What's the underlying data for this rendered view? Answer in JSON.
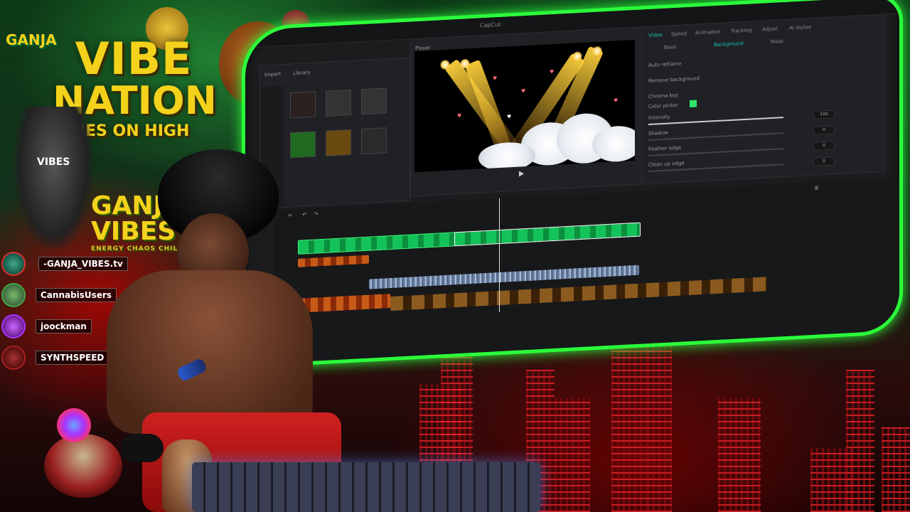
{
  "overlay": {
    "ganja_small": "GANJA",
    "title_line1": "VIBE",
    "title_line2": "NATION",
    "title_line3": "VIBES ON HIGH",
    "shirt_text": "VIBES",
    "logo_line1": "GANJ",
    "logo_line2": "VIBES",
    "logo_sub": "ENERGY CHAOS CHILL"
  },
  "chat_users": [
    {
      "name": "-GANJA_VIBES.tv",
      "icon": "avatar-icon"
    },
    {
      "name": "CannabisUsers",
      "icon": "avatar-icon"
    },
    {
      "name": "joockman",
      "icon": "avatar-icon"
    },
    {
      "name": "SYNTHSPEED",
      "icon": "avatar-icon"
    }
  ],
  "editor": {
    "window_title": "CapCut",
    "media_tabs": [
      "Import",
      "Library"
    ],
    "media_items": [
      {
        "label": ""
      },
      {
        "label": ""
      },
      {
        "label": ""
      },
      {
        "label": ""
      },
      {
        "label": ""
      },
      {
        "label": ""
      }
    ],
    "player_label": "Player",
    "right_tabs": [
      "Video",
      "Speed",
      "Animation",
      "Tracking",
      "Adjust",
      "AI stylize"
    ],
    "sub_tabs": [
      "Basic",
      "Background",
      "Mask"
    ],
    "props": [
      "Auto reframe",
      "Remove background",
      "Chroma key",
      "Color picker",
      "Intensity",
      "Shadow",
      "Feather edge",
      "Clean up edge"
    ],
    "prop_values": [
      "100",
      "0",
      "0",
      "0"
    ],
    "playhead_fraction": 0.36,
    "colors": {
      "accent": "#1ec8b8",
      "monitor_glow": "#2bff3a",
      "video_clip": "#14c25a",
      "overlay_gold": "#f4d21c"
    }
  }
}
